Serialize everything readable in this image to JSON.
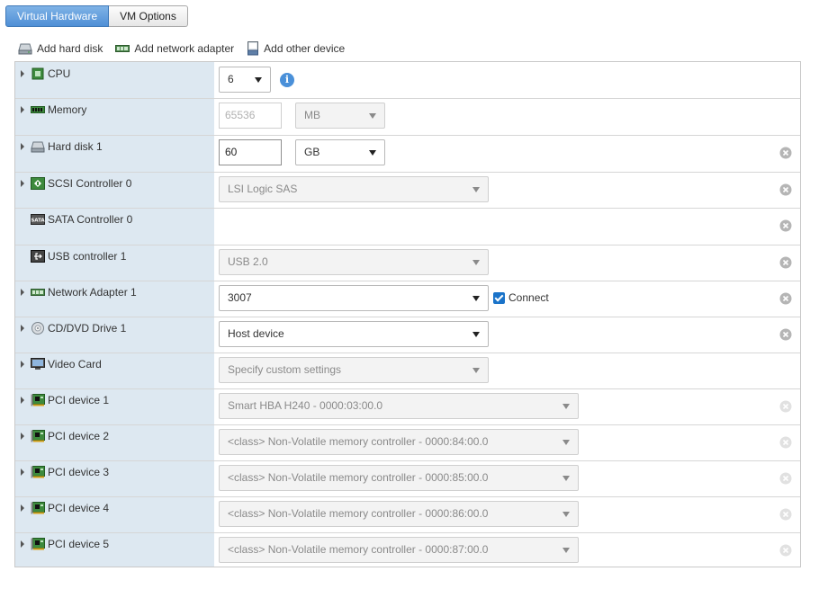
{
  "tabs": [
    {
      "label": "Virtual Hardware",
      "active": true
    },
    {
      "label": "VM Options",
      "active": false
    }
  ],
  "toolbar": {
    "add_hard_disk": "Add hard disk",
    "add_network_adapter": "Add network adapter",
    "add_other_device": "Add other device"
  },
  "devices": {
    "cpu": {
      "label": "CPU",
      "value": "6"
    },
    "memory": {
      "label": "Memory",
      "value": "65536",
      "unit": "MB"
    },
    "hard_disk": {
      "label": "Hard disk 1",
      "value": "60",
      "unit": "GB"
    },
    "scsi": {
      "label": "SCSI Controller 0",
      "value": "LSI Logic SAS"
    },
    "sata": {
      "label": "SATA Controller 0"
    },
    "usb": {
      "label": "USB controller 1",
      "value": "USB 2.0"
    },
    "network": {
      "label": "Network Adapter 1",
      "value": "3007",
      "connect_label": "Connect",
      "connected": true
    },
    "cdrom": {
      "label": "CD/DVD Drive 1",
      "value": "Host device"
    },
    "video": {
      "label": "Video Card",
      "value": "Specify custom settings"
    },
    "pci": [
      {
        "label": "PCI device 1",
        "value": "Smart HBA H240 - 0000:03:00.0"
      },
      {
        "label": "PCI device 2",
        "value": "<class> Non-Volatile memory controller - 0000:84:00.0"
      },
      {
        "label": "PCI device 3",
        "value": "<class> Non-Volatile memory controller - 0000:85:00.0"
      },
      {
        "label": "PCI device 4",
        "value": "<class> Non-Volatile memory controller - 0000:86:00.0"
      },
      {
        "label": "PCI device 5",
        "value": "<class> Non-Volatile memory controller - 0000:87:00.0"
      }
    ]
  },
  "colors": {
    "accent": "#4f8fd6",
    "label_column": "#dde8f1",
    "checkbox": "#1a73c9"
  }
}
